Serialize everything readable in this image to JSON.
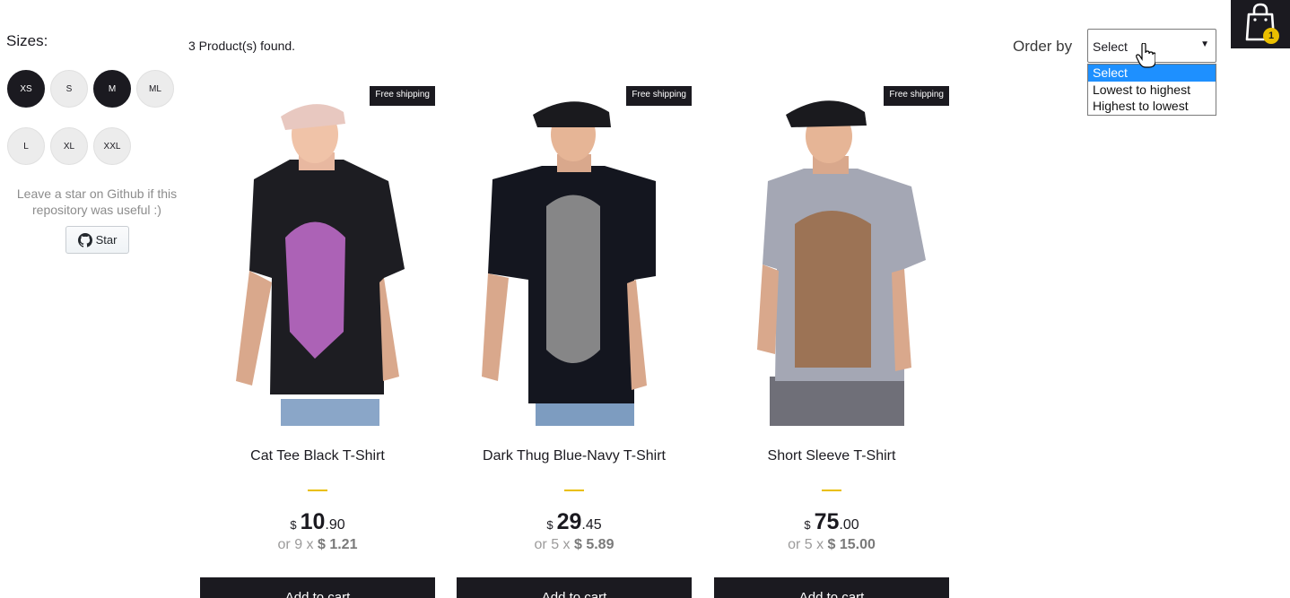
{
  "filters": {
    "title": "Sizes:",
    "sizes": [
      "XS",
      "S",
      "M",
      "ML",
      "L",
      "XL",
      "XXL"
    ],
    "active_sizes": [
      "XS",
      "M"
    ]
  },
  "github": {
    "note": "Leave a star on Github if this repository was useful :)",
    "star_label": "Star"
  },
  "shelf": {
    "found_text": "3 Product(s) found.",
    "order_label": "Order by",
    "order_selected": "Select",
    "order_options": [
      "Select",
      "Lowest to highest",
      "Highest to lowest"
    ]
  },
  "cart": {
    "count": "1"
  },
  "products": [
    {
      "title": "Cat Tee Black T-Shirt",
      "badge": "Free shipping",
      "currency": "$",
      "price_int": "10",
      "price_dec": ".90",
      "installment_prefix": "or 9 x",
      "installment_value": "$ 1.21",
      "button": "Add to cart",
      "shirt_color": "#1d1d22",
      "print_color": "#c56fd0"
    },
    {
      "title": "Dark Thug Blue-Navy T-Shirt",
      "badge": "Free shipping",
      "currency": "$",
      "price_int": "29",
      "price_dec": ".45",
      "installment_prefix": "or 5 x",
      "installment_value": "$ 5.89",
      "button": "Add to cart",
      "shirt_color": "#14161f",
      "print_color": "#9a9a9a"
    },
    {
      "title": "Short Sleeve T-Shirt",
      "badge": "Free shipping",
      "currency": "$",
      "price_int": "75",
      "price_dec": ".00",
      "installment_prefix": "or 5 x",
      "installment_value": "$ 15.00",
      "button": "Add to cart",
      "shirt_color": "#a4a7b4",
      "print_color": "#9b6a44"
    }
  ],
  "colors": {
    "dark": "#1b1a20",
    "accent": "#eabf00",
    "dropdown_highlight": "#1e90ff"
  }
}
